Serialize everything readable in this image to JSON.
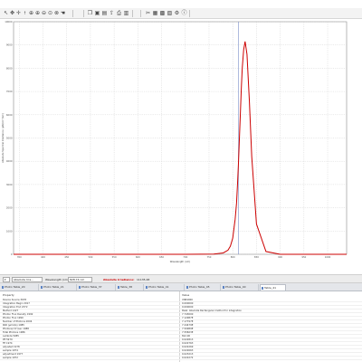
{
  "toolbar": {
    "icons": [
      "arrow-select-icon",
      "pan-icon",
      "move-icon",
      "cursor-line-icon",
      "zoom-in-icon",
      "zoom-in-alt-icon",
      "zoom-out-icon",
      "zoom-fit-icon",
      "zoom-reset-icon",
      "hand-icon",
      "copy-icon",
      "save-icon",
      "image-icon",
      "export-icon",
      "print-icon",
      "properties-icon",
      "tools-icon",
      "chart-icon",
      "grid-icon",
      "table-icon",
      "settings-icon",
      "info-icon"
    ]
  },
  "plot": {
    "ylabel": "Absolute Spectral Irradiance (μW/cm²/nm)",
    "xlabel": "Wavelength (nm)",
    "grid": true,
    "line_color": "#cc0000",
    "marker_color": "#7a8ec8"
  },
  "chart_data": {
    "type": "line",
    "title": "",
    "xlabel": "Wavelength (nm)",
    "ylabel": "Absolute Spectral Irradiance (μW/cm²/nm)",
    "xlim": [
      338,
      1040
    ],
    "ylim": [
      0,
      10000
    ],
    "x_ticks": [
      "350",
      "400",
      "450",
      "500",
      "550",
      "600",
      "650",
      "700",
      "750",
      "800",
      "850",
      "900",
      "950",
      "1000"
    ],
    "y_ticks": [
      "0",
      "1000",
      "2000",
      "3000",
      "4000",
      "5000",
      "6000",
      "7000",
      "8000",
      "9000",
      "10000"
    ],
    "series": [
      {
        "x": [
          338,
          400,
          500,
          600,
          700,
          760,
          780,
          790,
          795,
          800,
          805,
          808,
          810,
          812,
          815,
          818,
          820,
          823,
          826,
          830,
          835,
          840,
          850,
          870,
          900,
          1000,
          1040
        ],
        "y": [
          0,
          0,
          0,
          0,
          0,
          10,
          60,
          180,
          350,
          700,
          1500,
          2200,
          3000,
          3900,
          5500,
          7100,
          8000,
          8800,
          9150,
          8600,
          6600,
          4200,
          1300,
          120,
          0,
          0,
          0
        ]
      }
    ],
    "marker_x": 812
  },
  "statusbar": {
    "mode_select": "Absolute Irra...",
    "wavelength_label": "Wavelength (nm):",
    "wavelength_value": "828.74 nm",
    "result_label": "Absolute Irradiance:",
    "result_value": "11135.48"
  },
  "tabs": [
    "Photo Table_20",
    "Photo Table_21",
    "Photo Table_37",
    "Table_38",
    "Photo Table_41",
    "Photo Table_45",
    "Photo Table_40",
    "Table_41"
  ],
  "table": {
    "col_property": "Property",
    "col_value": "Value",
    "rows": [
      {
        "property": "Device Source 3678",
        "value": "USB4000"
      },
      {
        "property": "Integration Begin 2017",
        "value": "0.000000"
      },
      {
        "property": "Integration End 2372",
        "value": "0.000000"
      },
      {
        "property": "Method 1427",
        "value": "Peak: Absolute Rectangular method for integration"
      },
      {
        "property": "Photon Flux Density 1992",
        "value": "7.743000"
      },
      {
        "property": "Photon Flux 1999",
        "value": "7.12987E"
      },
      {
        "property": "Number of Photons 2004",
        "value": "7.17797E"
      },
      {
        "property": "PAR (μmol/s) 1985",
        "value": "7.24479E"
      },
      {
        "property": "Photons/cm²/sec 1988",
        "value": "7.50989E"
      },
      {
        "property": "Total Photons 1986",
        "value": "7.55823E"
      },
      {
        "property": "Lambda 5985",
        "value": "812.00"
      },
      {
        "property": "PE 5979",
        "value": "0.022813"
      },
      {
        "property": "FE 1974",
        "value": "0.022763"
      },
      {
        "property": "adjusted 1978",
        "value": "0.022269"
      },
      {
        "property": "sample 1974",
        "value": "0.022663"
      },
      {
        "property": "adjustment 1977",
        "value": "0.023213"
      },
      {
        "property": "sample 1972",
        "value": "0.022272"
      }
    ]
  }
}
